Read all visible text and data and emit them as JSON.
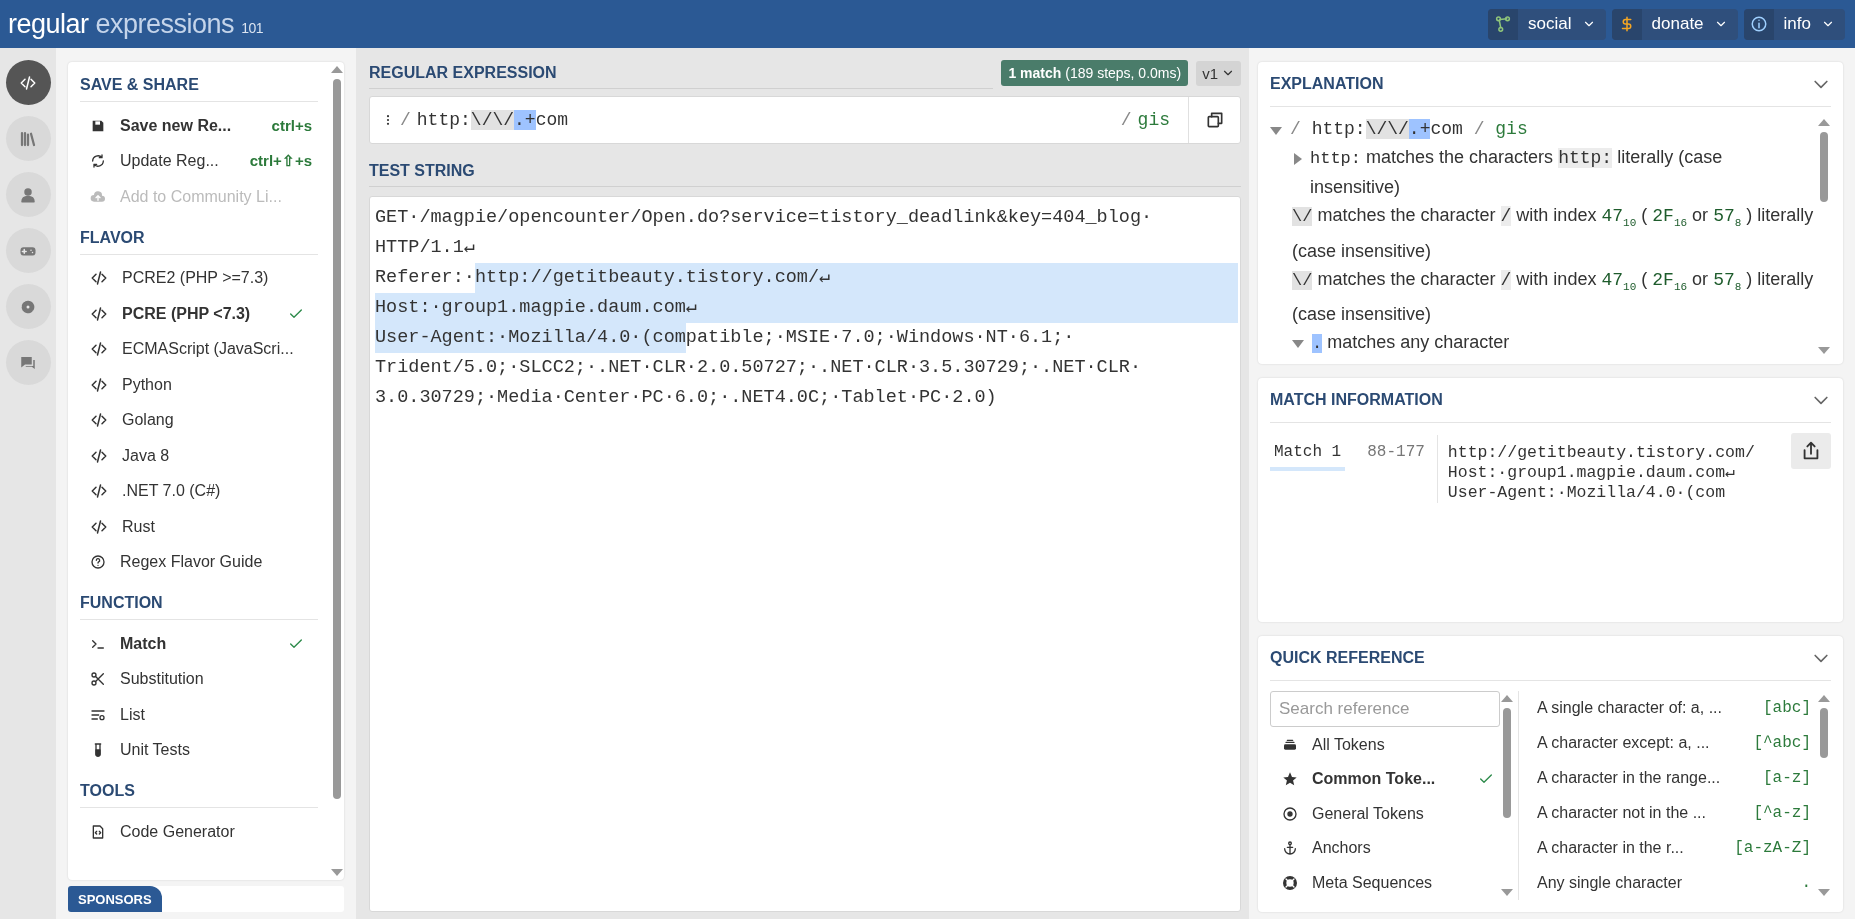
{
  "header": {
    "logo": {
      "word_1": "regular",
      "word_2": "expressions",
      "suffix": "101"
    },
    "menus": [
      {
        "label": "social"
      },
      {
        "label": "donate"
      },
      {
        "label": "info"
      }
    ]
  },
  "rail": [
    {
      "selected": true
    },
    {
      "selected": false
    },
    {
      "selected": false
    },
    {
      "selected": false
    },
    {
      "selected": false
    },
    {
      "selected": false
    }
  ],
  "sidebar": {
    "sections": [
      {
        "title": "SAVE & SHARE",
        "items": [
          {
            "kind": "action",
            "label": "Save new Re...",
            "shortcut": "ctrl+s",
            "bold": true,
            "disabled": false
          },
          {
            "kind": "action",
            "label": "Update Reg...",
            "shortcut": "ctrl+⇧+s",
            "bold": false,
            "disabled": false
          },
          {
            "kind": "action",
            "label": "Add to Community Li...",
            "bold": false,
            "disabled": true
          }
        ]
      },
      {
        "title": "FLAVOR",
        "items": [
          {
            "kind": "option",
            "label": "PCRE2 (PHP >=7.3)",
            "selected": false
          },
          {
            "kind": "option",
            "label": "PCRE (PHP <7.3)",
            "selected": true
          },
          {
            "kind": "option",
            "label": "ECMAScript (JavaScri...",
            "selected": false
          },
          {
            "kind": "option",
            "label": "Python",
            "selected": false
          },
          {
            "kind": "option",
            "label": "Golang",
            "selected": false
          },
          {
            "kind": "option",
            "label": "Java 8",
            "selected": false
          },
          {
            "kind": "option",
            "label": ".NET 7.0 (C#)",
            "selected": false
          },
          {
            "kind": "option",
            "label": "Rust",
            "selected": false
          },
          {
            "kind": "action",
            "label": "Regex Flavor Guide",
            "bold": false,
            "disabled": false
          }
        ]
      },
      {
        "title": "FUNCTION",
        "items": [
          {
            "kind": "option",
            "label": "Match",
            "selected": true
          },
          {
            "kind": "option",
            "label": "Substitution",
            "selected": false
          },
          {
            "kind": "option",
            "label": "List",
            "selected": false
          },
          {
            "kind": "option",
            "label": "Unit Tests",
            "selected": false
          }
        ]
      },
      {
        "title": "TOOLS",
        "items": [
          {
            "kind": "action",
            "label": "Code Generator",
            "bold": false,
            "disabled": false
          }
        ]
      }
    ]
  },
  "sponsors": {
    "label": "SPONSORS"
  },
  "regex": {
    "title": "REGULAR EXPRESSION",
    "match_badge": {
      "count": "1 match",
      "detail": "(189 steps, 0.0ms)"
    },
    "version": "v1",
    "delimiter_open": "/",
    "segments": [
      {
        "kind": "plain",
        "text": "http:"
      },
      {
        "kind": "escape",
        "text": "\\/\\/"
      },
      {
        "kind": "selected",
        "text": ".+"
      },
      {
        "kind": "plain",
        "text": "com"
      }
    ],
    "delimiter_close": "/",
    "flags": "gis"
  },
  "test_string": {
    "title": "TEST STRING",
    "lines": [
      [
        {
          "text": "GET·/magpie/opencounter/Open.do?service=tistory_deadlink&key=404_blog·",
          "match": false
        }
      ],
      [
        {
          "text": "HTTP/1.1↵",
          "match": false
        }
      ],
      [
        {
          "text": "Referer:·",
          "match": false
        },
        {
          "text": "http://getitbeauty.tistory.com/↵",
          "match": true
        }
      ],
      [
        {
          "text": "Host:·group1.magpie.daum.com↵",
          "match": true
        }
      ],
      [
        {
          "text": "User-Agent:·Mozilla/4.0·(com",
          "match": true
        },
        {
          "text": "patible;·MSIE·7.0;·Windows·NT·6.1;·",
          "match": false
        }
      ],
      [
        {
          "text": "Trident/5.0;·SLCC2;·.NET·CLR·2.0.50727;·.NET·CLR·3.5.30729;·.NET·CLR·",
          "match": false
        }
      ],
      [
        {
          "text": "3.0.30729;·Media·Center·PC·6.0;·.NET4.0C;·Tablet·PC·2.0)",
          "match": false
        }
      ]
    ]
  },
  "explanation": {
    "title": "EXPLANATION",
    "root": {
      "expanded": true,
      "delimiter_open": "/",
      "segments": [
        {
          "kind": "plain",
          "text": "http:"
        },
        {
          "kind": "escape",
          "text": "\\/\\/"
        },
        {
          "kind": "selected",
          "text": ".+"
        },
        {
          "kind": "plain",
          "text": "com"
        }
      ],
      "delimiter_close": "/",
      "flags": "gis",
      "children": [
        {
          "kind": "branch",
          "expanded": false,
          "token": {
            "kind": "plain",
            "text": "http:"
          },
          "parts": [
            {
              "kind": "text",
              "text": "matches the characters"
            },
            {
              "kind": "code",
              "text": "http:"
            },
            {
              "kind": "text",
              "text": "literally (case insensitive)"
            }
          ]
        },
        {
          "kind": "leaf",
          "token": {
            "kind": "escape",
            "text": "\\/"
          },
          "parts": [
            {
              "kind": "text",
              "text": "matches the character"
            },
            {
              "kind": "code",
              "text": "/"
            },
            {
              "kind": "text",
              "text": "with index"
            },
            {
              "kind": "num",
              "text": "47$_{10}$"
            },
            {
              "kind": "text",
              "text": "("
            },
            {
              "kind": "num",
              "text": "2F$_{16}$"
            },
            {
              "kind": "text",
              "text": "or"
            },
            {
              "kind": "num",
              "text": "57$_{8}$"
            },
            {
              "kind": "text",
              "text": ") literally (case insensitive)"
            }
          ]
        },
        {
          "kind": "leaf",
          "token": {
            "kind": "escape",
            "text": "\\/"
          },
          "parts": [
            {
              "kind": "text",
              "text": "matches the character"
            },
            {
              "kind": "code",
              "text": "/"
            },
            {
              "kind": "text",
              "text": "with index"
            },
            {
              "kind": "num",
              "text": "47$_{10}$"
            },
            {
              "kind": "text",
              "text": "("
            },
            {
              "kind": "num",
              "text": "2F$_{16}$"
            },
            {
              "kind": "text",
              "text": "or"
            },
            {
              "kind": "num",
              "text": "57$_{8}$"
            },
            {
              "kind": "text",
              "text": ") literally (case insensitive)"
            }
          ]
        },
        {
          "kind": "branch",
          "expanded": true,
          "token": {
            "kind": "selected",
            "text": "."
          },
          "parts": [
            {
              "kind": "text",
              "text": "matches any character"
            }
          ]
        }
      ]
    }
  },
  "match_information": {
    "title": "MATCH INFORMATION",
    "matches": [
      {
        "label": "Match 1",
        "range": "88-177",
        "lines": [
          "http://getitbeauty.tistory.com/",
          "Host:·group1.magpie.daum.com↵",
          "User-Agent:·Mozilla/4.0·(com"
        ]
      }
    ]
  },
  "quick_reference": {
    "title": "QUICK REFERENCE",
    "search": {
      "placeholder": "Search reference"
    },
    "categories": [
      {
        "label": "All Tokens",
        "selected": false
      },
      {
        "label": "Common Toke...",
        "selected": true
      },
      {
        "label": "General Tokens",
        "selected": false
      },
      {
        "label": "Anchors",
        "selected": false
      },
      {
        "label": "Meta Sequences",
        "selected": false
      }
    ],
    "entries": [
      {
        "description": "A single character of: a, ...",
        "token": "[abc]"
      },
      {
        "description": "A character except: a, ...",
        "token": "[^abc]"
      },
      {
        "description": "A character in the range...",
        "token": "[a-z]"
      },
      {
        "description": "A character not in the ...",
        "token": "[^a-z]"
      },
      {
        "description": "A character in the r...",
        "token": "[a-zA-Z]"
      },
      {
        "description": "Any single character",
        "token": "."
      }
    ]
  }
}
